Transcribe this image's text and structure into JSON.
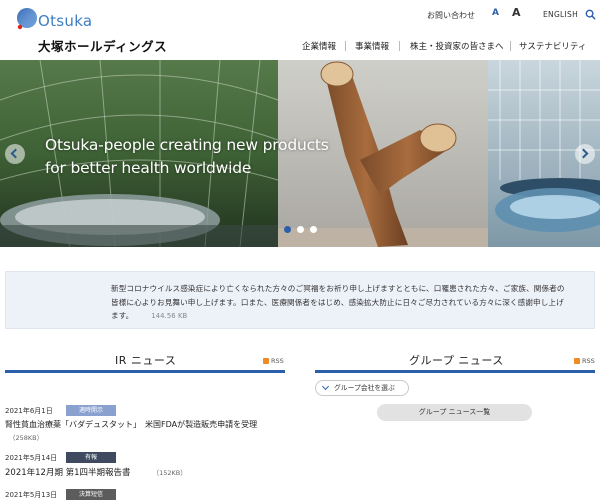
{
  "header": {
    "logo_latin": "Otsuka",
    "logo_jp": "大塚ホールディングス",
    "contact": "お問い合わせ",
    "font_small": "A",
    "font_large": "A",
    "english": "ENGLISH",
    "search_icon": "search-icon"
  },
  "gnav": {
    "items": [
      {
        "label": "企業情報"
      },
      {
        "label": "事業情報"
      },
      {
        "label": "株主・投資家の皆さまへ"
      },
      {
        "label": "サステナビリティ"
      }
    ]
  },
  "hero": {
    "line1": "Otsuka-people creating new products",
    "line2": "for better health worldwide",
    "prev_icon": "chevron-left-icon",
    "next_icon": "chevron-right-icon",
    "slides_total": 3,
    "active_slide": 1
  },
  "notice": {
    "text": "新型コロナウイルス感染症により亡くなられた方々のご冥福をお祈り申し上げますとともに、口罹患された方々、ご家族、関係者の皆様に心よりお見舞い申し上げます。口また、医療関係者をはじめ、感染拡大防止に日々ご尽力されている方々に深く感謝申し上げます。",
    "size": "144.56 KB"
  },
  "ir_news": {
    "title": "IR ニュース",
    "rss": "RSS",
    "items": [
      {
        "date": "2021年6月1日",
        "badge": "適時開示",
        "badge_color": "#8aa0cf",
        "title": "腎性貧血治療薬「バダデュスタット」　米国FDAが製造販売申請を受理",
        "kb": "（258KB）"
      },
      {
        "date": "2021年5月14日",
        "badge": "有報",
        "badge_color": "#3f4a60",
        "title": "2021年12月期 第1四半期報告書",
        "kb": "（152KB）"
      },
      {
        "date": "2021年5月13日",
        "badge": "決算短信",
        "badge_color": "#5c5c5c",
        "title": "",
        "kb": ""
      }
    ]
  },
  "group_news": {
    "title": "グループ ニュース",
    "rss": "RSS",
    "filter_label": "グループ会社を選ぶ",
    "list_label": "グループ ニュース一覧"
  },
  "colors": {
    "accent": "#2b5fab",
    "notice_bg": "#edf1f8",
    "rss": "#f08a24"
  }
}
